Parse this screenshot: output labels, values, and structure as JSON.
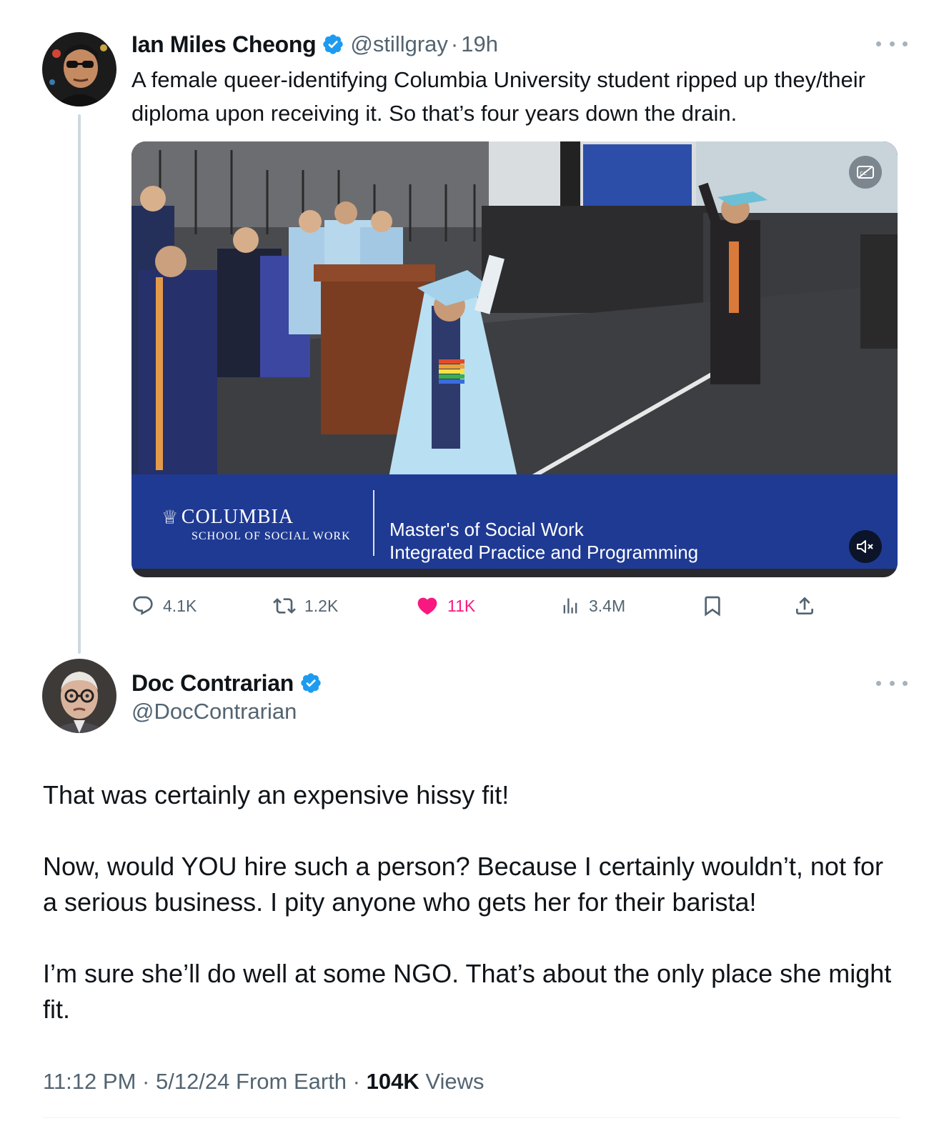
{
  "colors": {
    "text_primary": "#0f1419",
    "text_secondary": "#536471",
    "verified_blue": "#1d9bf0",
    "like_pink": "#f91880",
    "thread_line": "#cfd9de",
    "lower_third_blue": "#1f3a93"
  },
  "tweet1": {
    "author": {
      "display_name": "Ian Miles Cheong",
      "verified_icon": "verified-badge-icon",
      "handle": "@stillgray",
      "separator": "·",
      "time": "19h"
    },
    "text": "A female queer-identifying Columbia University student ripped up they/their diploma upon receiving it. So that’s four years down the drain.",
    "media": {
      "type": "video",
      "lower_third": {
        "crown_glyph": "♕",
        "university": "COLUMBIA",
        "school": "SCHOOL OF SOCIAL WORK",
        "line1": "Master's of Social Work",
        "line2": "Integrated Practice and Programming"
      },
      "icons": [
        "captions-off-icon",
        "muted-speaker-icon"
      ]
    },
    "actions": {
      "replies": "4.1K",
      "reposts": "1.2K",
      "likes": "11K",
      "views": "3.4M",
      "icons": [
        "reply-icon",
        "repost-icon",
        "like-icon",
        "views-icon",
        "bookmark-icon",
        "share-icon"
      ]
    }
  },
  "tweet2": {
    "author": {
      "display_name": "Doc Contrarian",
      "verified_icon": "verified-badge-icon",
      "handle": "@DocContrarian"
    },
    "paragraphs": [
      "That was certainly an expensive hissy fit!",
      "Now, would YOU hire such a person? Because I certainly wouldn’t, not for a serious business. I pity anyone who gets her for their barista!",
      "I’m sure she’ll do well at some NGO. That’s about the only place she might fit."
    ],
    "meta": {
      "time": "11:12 PM",
      "separator": "·",
      "date_source": "5/12/24 From Earth",
      "separator2": "·",
      "views_count": "104K",
      "views_label": "Views"
    }
  }
}
